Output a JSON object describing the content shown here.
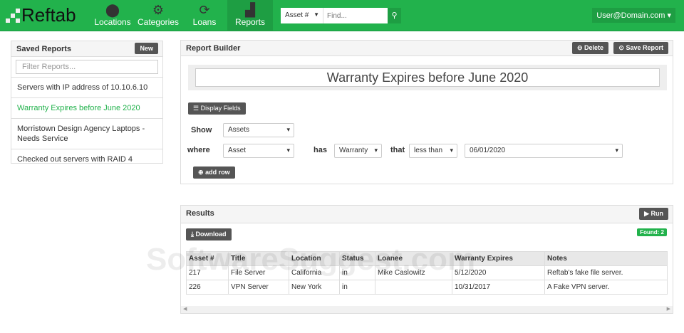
{
  "nav": {
    "logo": "Reftab",
    "items": [
      {
        "label": "Locations",
        "icon": "map-marker-icon"
      },
      {
        "label": "Categories",
        "icon": "gears-icon"
      },
      {
        "label": "Loans",
        "icon": "refresh-icon"
      },
      {
        "label": "Reports",
        "icon": "bar-chart-icon"
      }
    ],
    "search": {
      "select": "Asset #",
      "placeholder": "Find..."
    },
    "user": "User@Domain.com"
  },
  "saved": {
    "title": "Saved Reports",
    "new_label": "New",
    "filter_placeholder": "Filter Reports...",
    "items": [
      "Servers with IP address of 10.10.6.10",
      "Warranty Expires before June 2020",
      "Morristown Design Agency Laptops - Needs Service",
      "Checked out servers with RAID 4"
    ]
  },
  "builder": {
    "title": "Report Builder",
    "delete_label": "Delete",
    "save_label": "Save Report",
    "report_title": "Warranty Expires before June 2020",
    "display_fields": "Display Fields",
    "show_label": "Show",
    "show_value": "Assets",
    "where_label": "where",
    "where_value": "Asset",
    "has_label": "has",
    "has_value": "Warranty",
    "that_label": "that",
    "that_value": "less than",
    "date_value": "06/01/2020",
    "add_row": "add row"
  },
  "results": {
    "title": "Results",
    "run_label": "Run",
    "download_label": "Download",
    "found": "Found: 2",
    "columns": [
      "Asset #",
      "Title",
      "Location",
      "Status",
      "Loanee",
      "Warranty Expires",
      "Notes"
    ],
    "rows": [
      [
        "217",
        "File Server",
        "California",
        "in",
        "Mike Caslowitz",
        "5/12/2020",
        "Reftab's fake file server."
      ],
      [
        "226",
        "VPN Server",
        "New York",
        "in",
        "",
        "10/31/2017",
        "A Fake VPN server."
      ]
    ]
  },
  "watermark": "SoftwareSuggest.com"
}
